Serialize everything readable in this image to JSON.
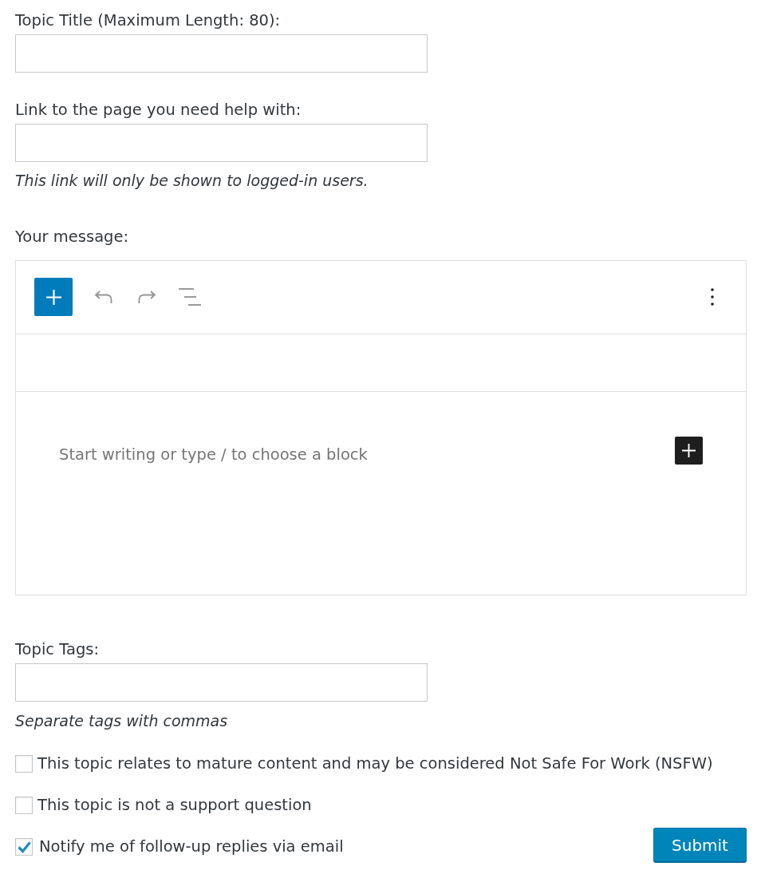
{
  "fields": [
    {
      "label": "Topic Title (Maximum Length: 80):"
    },
    {
      "label": "Link to the page you need help with:",
      "description": "This link will only be shown to logged-in users."
    }
  ],
  "message": {
    "label": "Your message:",
    "placeholder": "Start writing or type / to choose a block"
  },
  "tags": {
    "label": "Topic Tags:",
    "description": "Separate tags with commas"
  },
  "options": [
    {
      "label": "This topic relates to mature content and may be considered Not Safe For Work (NSFW)",
      "checked": false
    },
    {
      "label": "This topic is not a support question",
      "checked": false
    },
    {
      "label": "Notify me of follow-up replies via email",
      "checked": true
    }
  ],
  "submit": {
    "label": "Submit"
  }
}
